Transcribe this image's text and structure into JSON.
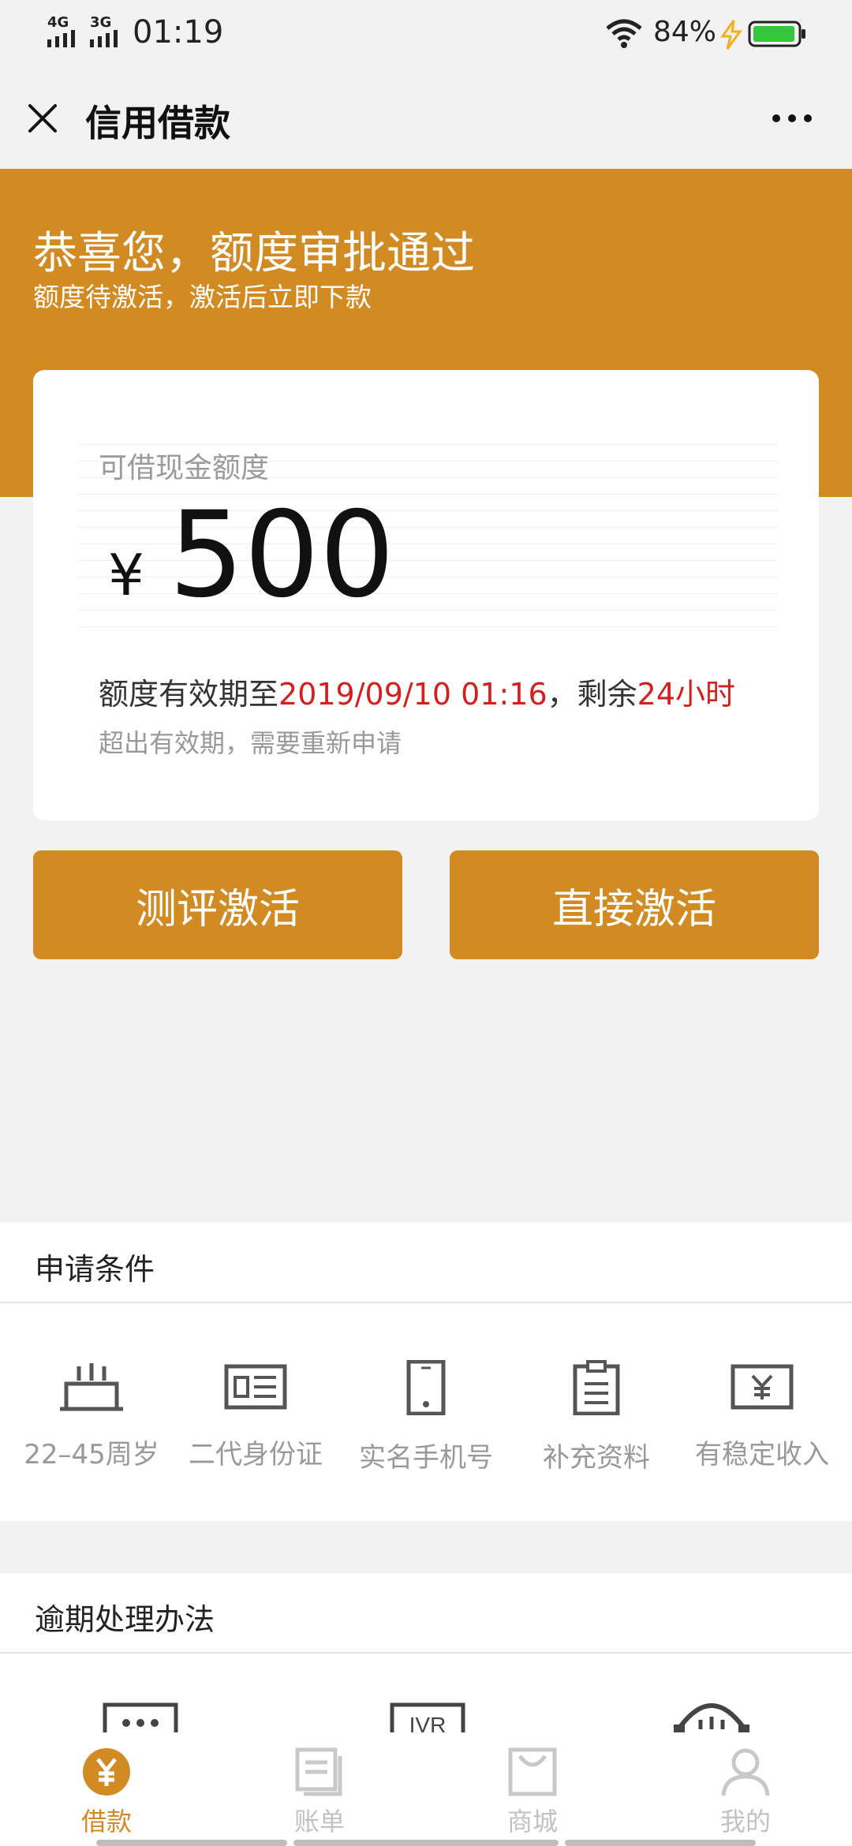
{
  "status_bar": {
    "network_1": "4G",
    "network_2": "3G",
    "time": "01:19",
    "battery": "84%"
  },
  "nav": {
    "title": "信用借款",
    "close_icon": "close-icon",
    "more_icon": "more-dots-icon"
  },
  "hero": {
    "title": "恭喜您，额度审批通过",
    "subtitle": "额度待激活，激活后立即下款"
  },
  "card": {
    "label": "可借现金额度",
    "currency": "¥",
    "amount": "500",
    "validity_prefix": "额度有效期至",
    "validity_date": "2019/09/10 01:16",
    "validity_mid": "，剩余",
    "validity_remaining": "24小时",
    "note": "超出有效期，需要重新申请"
  },
  "buttons": {
    "evaluate": "测评激活",
    "direct": "直接激活"
  },
  "conditions": {
    "title": "申请条件",
    "items": [
      {
        "label": "22–45周岁",
        "icon": "cake-icon"
      },
      {
        "label": "二代身份证",
        "icon": "id-card-icon"
      },
      {
        "label": "实名手机号",
        "icon": "phone-icon"
      },
      {
        "label": "补充资料",
        "icon": "clipboard-icon"
      },
      {
        "label": "有稳定收入",
        "icon": "yen-bill-icon"
      }
    ]
  },
  "overdue": {
    "title": "逾期处理办法",
    "icons": [
      "message-icon",
      "ivr-icon",
      "headset-icon"
    ],
    "ivr_text": "IVR"
  },
  "tabs": [
    {
      "label": "借款",
      "icon": "yen-circle-icon",
      "active": true
    },
    {
      "label": "账单",
      "icon": "bill-icon",
      "active": false
    },
    {
      "label": "商城",
      "icon": "shopping-bag-icon",
      "active": false
    },
    {
      "label": "我的",
      "icon": "user-icon",
      "active": false
    }
  ],
  "colors": {
    "brand": "#d18b22",
    "highlight": "#d41f1f",
    "background": "#f2f2f2"
  }
}
